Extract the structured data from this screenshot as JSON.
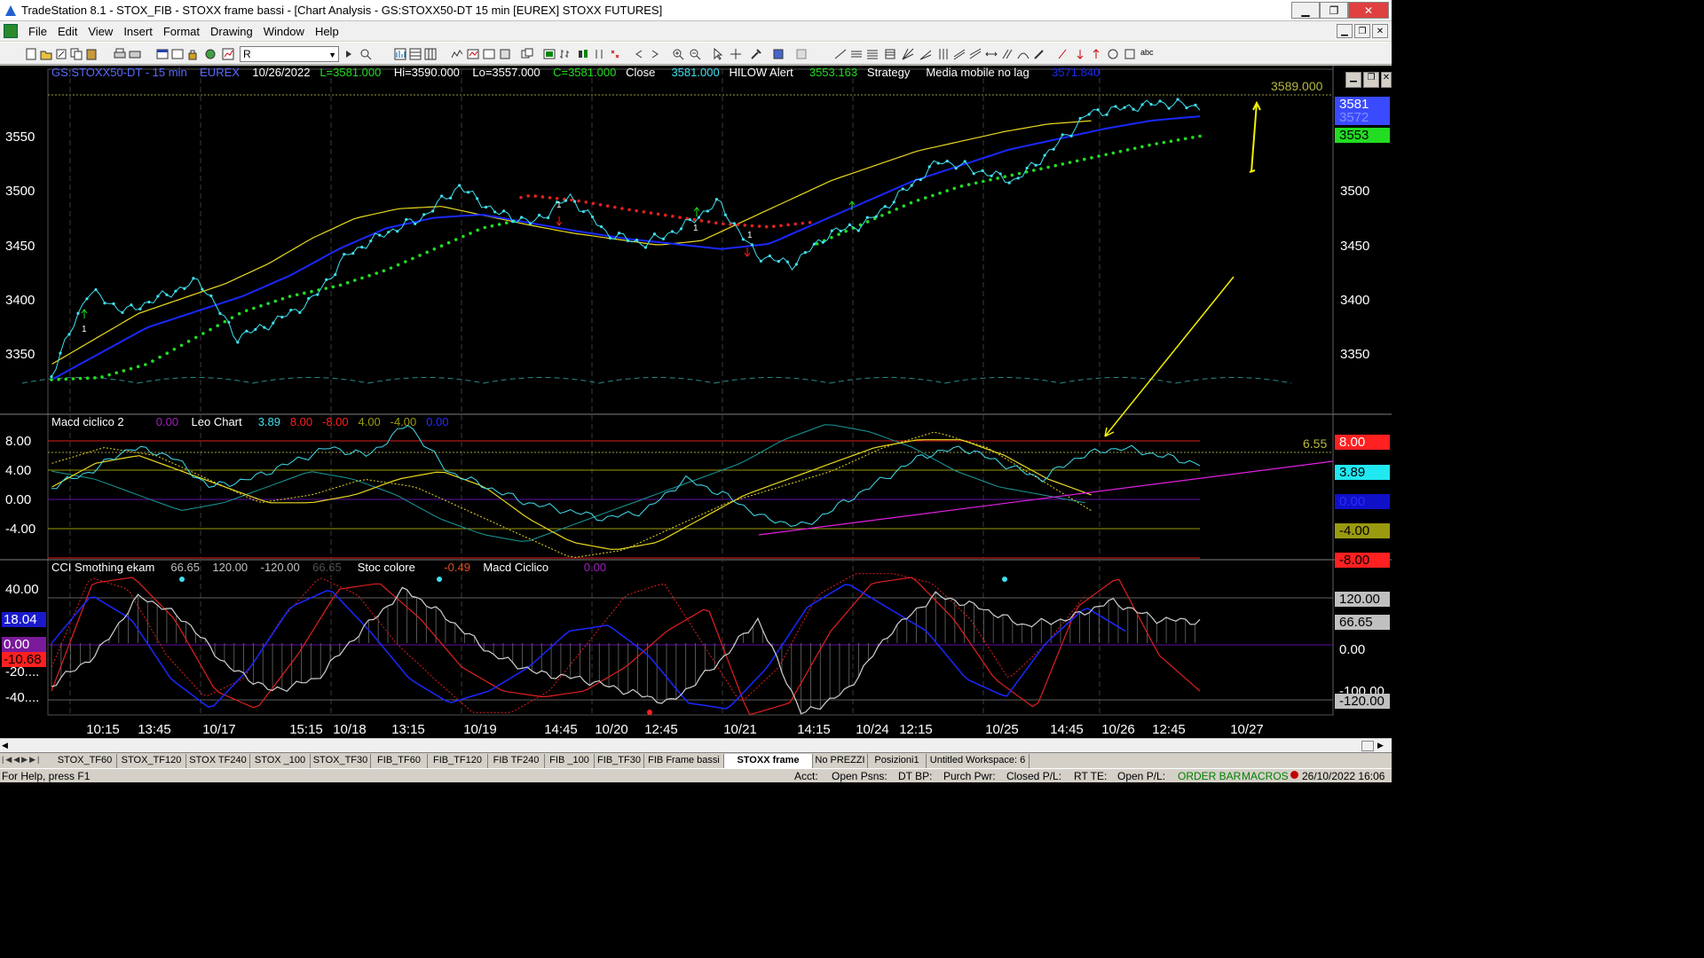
{
  "window": {
    "title": "TradeStation 8.1 - STOX_FIB - STOXX frame bassi - [Chart Analysis - GS:STOXX50-DT  15 min  [EUREX] STOXX FUTURES]",
    "minimize": "▁",
    "restore": "❐",
    "close": "✕"
  },
  "menu": [
    "File",
    "Edit",
    "View",
    "Insert",
    "Format",
    "Drawing",
    "Window",
    "Help"
  ],
  "mdi_controls": [
    "▁",
    "❐",
    "✕"
  ],
  "toolbar": {
    "symbol_value": "R",
    "dropdown": "▼",
    "abc": "abc"
  },
  "price_header": {
    "symbol": "GS:STOXX50-DT - 15 min",
    "exchange": "EUREX",
    "date": "10/26/2022",
    "last": "L=3581.000",
    "high": "Hi=3590.000",
    "low": "Lo=3557.000",
    "close_eq": "C=3581.000",
    "close_label": "Close",
    "close_value": "3581.000",
    "hilow_label": "HILOW Alert",
    "hilow_value": "3553.163",
    "strategy_label": "Strategy",
    "media_label": "Media mobile no lag",
    "media_value": "3571.840",
    "level_label": "3589.000"
  },
  "macd_header": {
    "name": "Macd ciclico 2",
    "v0": "0.00",
    "leo": "Leo Chart",
    "v1": "3.89",
    "v2": "8.00",
    "v3": "-8.00",
    "v4": "4.00",
    "v5": "-4.00",
    "v6": "0.00",
    "level_label": "6.55"
  },
  "cci_header": {
    "name": "CCI Smothing ekam",
    "v1": "66.65",
    "v2": "120.00",
    "v3": "-120.00",
    "v4": "66.65",
    "stoc": "Stoc colore",
    "stoc_val": "-0.49",
    "macd": "Macd Ciclico",
    "macd_val": "0.00"
  },
  "price_axis": {
    "left": [
      "3550",
      "3500",
      "3450",
      "3400",
      "3350"
    ],
    "right": [
      "3500",
      "3450",
      "3400",
      "3350"
    ],
    "badges": [
      {
        "text": "3581",
        "bg": "#3a4aff",
        "fg": "#ffffff"
      },
      {
        "text": "3572",
        "bg": "#3a4aff",
        "fg": "#8090ff"
      },
      {
        "text": "3553",
        "bg": "#22dd22",
        "fg": "#000000"
      }
    ]
  },
  "macd_axis": {
    "left": [
      "8.00",
      "4.00",
      "0.00",
      "-4.00"
    ],
    "badges": [
      {
        "text": "8.00",
        "bg": "#ff2020",
        "fg": "#ffffff"
      },
      {
        "text": "3.89",
        "bg": "#20e8f0",
        "fg": "#000000"
      },
      {
        "text": "0.00",
        "bg": "#1010c8",
        "fg": "#2a2aff"
      },
      {
        "text": "-4.00",
        "bg": "#9a9a10",
        "fg": "#000000"
      },
      {
        "text": "-8.00",
        "bg": "#ff2020",
        "fg": "#000000"
      }
    ]
  },
  "cci_axis": {
    "left": [
      "40.00",
      "-20....",
      "-40...."
    ],
    "left_badges": [
      {
        "text": "18.04",
        "bg": "#1a1acc",
        "fg": "#ffffff"
      },
      {
        "text": "0.00",
        "bg": "#7a1a9a",
        "fg": "#ffffff"
      },
      {
        "text": "-10.68",
        "bg": "#ff2020",
        "fg": "#000000"
      }
    ],
    "right": [
      {
        "text": "120.00",
        "bg": "#c0c0c0",
        "fg": "#000000"
      },
      {
        "text": "66.65",
        "bg": "#c0c0c0",
        "fg": "#000000"
      },
      {
        "text": "0.00",
        "bg": "#000000",
        "fg": "#ffffff"
      },
      {
        "text": "-100.00",
        "bg": "#000000",
        "fg": "#ffffff"
      },
      {
        "text": "-120.00",
        "bg": "#c0c0c0",
        "fg": "#000000"
      }
    ]
  },
  "time_axis": [
    "10:15",
    "13:45",
    "10/17",
    "15:15",
    "10/18",
    "13:15",
    "10/19",
    "14:45",
    "10/20",
    "12:45",
    "10/21",
    "14:15",
    "10/24",
    "12:15",
    "10/25",
    "14:45",
    "10/26",
    "12:45",
    "10/27"
  ],
  "tabs": [
    "STOX_TF60",
    "STOX_TF120",
    "STOX TF240",
    "STOX _100",
    "STOX_TF30",
    "FIB_TF60",
    "FIB_TF120",
    "FIB TF240",
    "FIB _100",
    "FIB_TF30",
    "FIB Frame bassi",
    "STOXX frame bassi",
    "No PREZZI",
    "Posizioni1",
    "Untitled Workspace: 6"
  ],
  "active_tab": "STOXX frame bassi",
  "status": {
    "help": "For Help, press F1",
    "acct": "Acct:",
    "open_psns": "Open Psns:",
    "dtbp": "DT BP:",
    "purch": "Purch Pwr:",
    "closed_pl": "Closed P/L:",
    "rtte": "RT TE:",
    "open_pl": "Open P/L:",
    "order_bar": "ORDER BAR",
    "macros": "MACROS",
    "datetime": "26/10/2022 16:06"
  },
  "colors": {
    "price_dots": "#40e0f0",
    "ma_blue": "#1a28ff",
    "ma_yellow": "#e8d820",
    "psar_green": "#22dd22",
    "psar_red": "#e02020",
    "annotation": "#f0f000",
    "trendline": "#e020e0"
  },
  "chart_data": [
    {
      "type": "line",
      "title": "GS:STOXX50-DT - 15 min",
      "x_labels": [
        "10:15",
        "13:45",
        "10/17",
        "15:15",
        "10/18",
        "13:15",
        "10/19",
        "14:45",
        "10/20",
        "12:45",
        "10/21",
        "14:15",
        "10/24",
        "12:15",
        "10/25",
        "14:45",
        "10/26",
        "12:45"
      ],
      "ylim": [
        3315,
        3595
      ],
      "series": [
        {
          "name": "Close",
          "values": [
            3325,
            3405,
            3385,
            3400,
            3415,
            3360,
            3375,
            3395,
            3440,
            3460,
            3475,
            3505,
            3480,
            3470,
            3495,
            3460,
            3450,
            3465,
            3490,
            3440,
            3430,
            3460,
            3470,
            3500,
            3530,
            3520,
            3510,
            3540,
            3575,
            3580,
            3585,
            3581
          ]
        },
        {
          "name": "Media mobile no lag",
          "values": [
            3320,
            3345,
            3370,
            3385,
            3400,
            3420,
            3445,
            3465,
            3475,
            3478,
            3470,
            3462,
            3455,
            3450,
            3445,
            3450,
            3470,
            3490,
            3510,
            3525,
            3540,
            3550,
            3560,
            3568,
            3572
          ]
        },
        {
          "name": "HILOW Alert",
          "values": [
            3320,
            3322,
            3335,
            3360,
            3385,
            3400,
            3410,
            3425,
            3445,
            3465,
            3475,
            3470,
            3462,
            3455,
            3448,
            3445,
            3450,
            3470,
            3490,
            3505,
            3515,
            3525,
            3535,
            3545,
            3553
          ]
        }
      ]
    },
    {
      "type": "line",
      "title": "Macd ciclico 2",
      "ylim": [
        -8,
        10
      ],
      "series": [
        {
          "name": "Leo Chart",
          "values": [
            1,
            3,
            6,
            5,
            1,
            2,
            4,
            6,
            5,
            9,
            3,
            1,
            -1,
            -2,
            -3,
            -2,
            2,
            0,
            -3,
            -4,
            -1,
            2,
            5,
            6,
            4,
            2,
            5,
            6,
            5,
            3.89
          ]
        }
      ]
    },
    {
      "type": "line",
      "title": "CCI Smothing ekam",
      "ylim": [
        -60,
        60
      ],
      "series": [
        {
          "name": "CCI Smothing ekam",
          "values": [
            -35,
            -10,
            40,
            20,
            -20,
            -40,
            -30,
            10,
            45,
            20,
            -10,
            -25,
            -30,
            -40,
            -50,
            -20,
            20,
            -60,
            -40,
            10,
            40,
            30,
            15,
            20,
            35,
            20,
            18
          ]
        }
      ]
    }
  ]
}
